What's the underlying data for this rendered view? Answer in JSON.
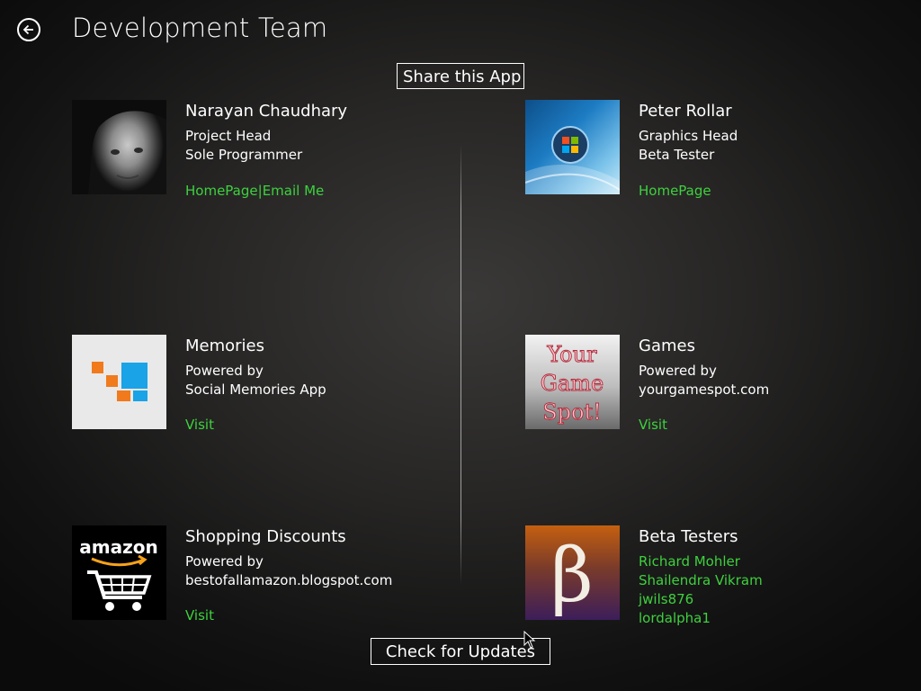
{
  "header": {
    "title": "Development Team",
    "back_icon": "arrow-left-icon"
  },
  "buttons": {
    "share": "Share this App",
    "updates": "Check for Updates"
  },
  "cards": {
    "narayan": {
      "name": "Narayan Chaudhary",
      "role1": "Project Head",
      "role2": "Sole Programmer",
      "link_home": "HomePage",
      "separator": "|",
      "link_email": "Email Me"
    },
    "peter": {
      "name": "Peter Rollar",
      "role1": "Graphics Head",
      "role2": "Beta Tester",
      "link_home": "HomePage"
    },
    "memories": {
      "name": "Memories",
      "line1": "Powered by",
      "line2": "Social Memories App",
      "link": "Visit"
    },
    "games": {
      "name": "Games",
      "line1": "Powered by",
      "line2": "yourgamespot.com",
      "link": "Visit",
      "logo_text": [
        "Your",
        "Game",
        "Spot!"
      ]
    },
    "shopping": {
      "name": "Shopping Discounts",
      "line1": "Powered by",
      "line2": "bestofallamazon.blogspot.com",
      "link": "Visit",
      "logo_text": "amazon"
    },
    "beta": {
      "name": "Beta Testers",
      "testers": [
        "Richard Mohler",
        "Shailendra Vikram",
        "jwils876",
        "lordalpha1"
      ],
      "logo_text": "β"
    }
  },
  "colors": {
    "link": "#3ed13e",
    "text": "#ffffff",
    "memories_orange": "#f07a1c",
    "memories_blue": "#1aa3e6",
    "beta_orange": "#c4600f",
    "beta_purple": "#3c1e5a"
  }
}
